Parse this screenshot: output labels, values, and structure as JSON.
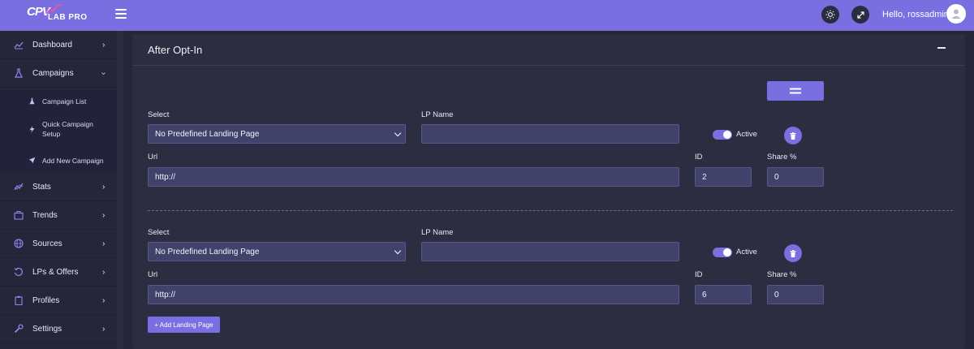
{
  "header": {
    "logo_cpv": "CPV",
    "logo_lab": "LAB PRO",
    "greeting": "Hello, rossadmin"
  },
  "sidebar": {
    "items": [
      {
        "label": "Dashboard",
        "icon": "chart-line-icon"
      },
      {
        "label": "Campaigns",
        "icon": "flask-icon"
      },
      {
        "label": "Stats",
        "icon": "trend-icon"
      },
      {
        "label": "Trends",
        "icon": "briefcase-icon"
      },
      {
        "label": "Sources",
        "icon": "globe-icon"
      },
      {
        "label": "LPs & Offers",
        "icon": "history-icon"
      },
      {
        "label": "Profiles",
        "icon": "clipboard-icon"
      },
      {
        "label": "Settings",
        "icon": "wrench-icon"
      }
    ],
    "sub_items": [
      {
        "label": "Campaign List",
        "icon": "flask-icon"
      },
      {
        "label": "Quick Campaign Setup",
        "icon": "bolt-icon"
      },
      {
        "label": "Add New Campaign",
        "icon": "paper-plane-icon"
      }
    ]
  },
  "card": {
    "title": "After Opt-In"
  },
  "labels": {
    "select": "Select",
    "lp_name": "LP Name",
    "url": "Url",
    "id": "ID",
    "share": "Share %",
    "active": "Active"
  },
  "rows": [
    {
      "select_value": "No Predefined Landing Page",
      "lp_name": "",
      "url": "http://",
      "id": "2",
      "share": "0",
      "active": true
    },
    {
      "select_value": "No Predefined Landing Page",
      "lp_name": "",
      "url": "http://",
      "id": "6",
      "share": "0",
      "active": true
    }
  ],
  "add_button": "+ Add Landing Page",
  "colors": {
    "accent": "#7a6fe0",
    "background": "#25263a",
    "card": "#2c2d41",
    "input": "#41426a"
  }
}
